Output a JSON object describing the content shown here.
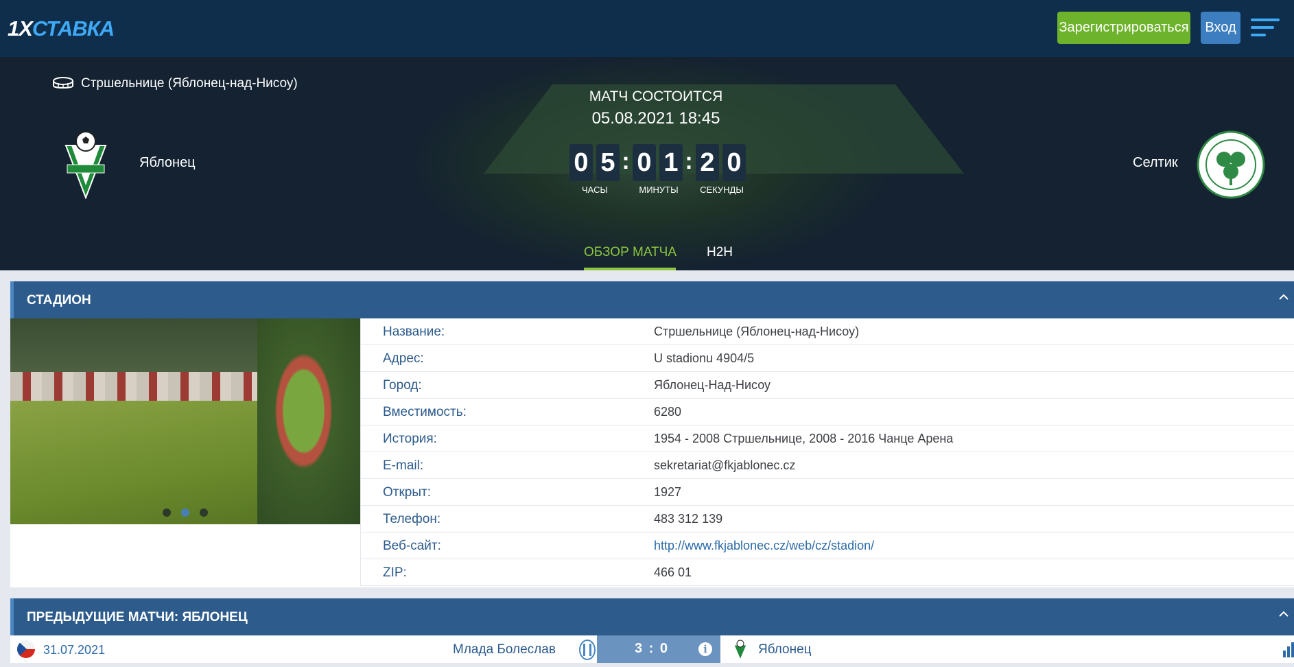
{
  "header": {
    "logo_prefix": "1X",
    "logo_suffix": "СТАВКА",
    "register_label": "Зарегистрироваться",
    "login_label": "Вход"
  },
  "match": {
    "venue": "Стршельнице (Яблонец-над-Нисоу)",
    "status": "МАТЧ СОСТОИТСЯ",
    "datetime": "05.08.2021 18:45",
    "home_team": "Яблонец",
    "away_team": "Селтик",
    "countdown": {
      "digits": [
        "0",
        "5",
        "0",
        "1",
        "2",
        "0"
      ],
      "units": [
        "ЧАСЫ",
        "МИНУТЫ",
        "СЕКУНДЫ"
      ]
    },
    "tabs": [
      {
        "label": "ОБЗОР МАТЧА",
        "active": true
      },
      {
        "label": "H2H",
        "active": false
      }
    ]
  },
  "stadium": {
    "section_title": "СТАДИОН",
    "photo_slide_count": 3,
    "photo_active_slide": 2,
    "rows": [
      {
        "label": "Название:",
        "value": "Стршельнице (Яблонец-над-Нисоу)"
      },
      {
        "label": "Адрес:",
        "value": "U stadionu 4904/5"
      },
      {
        "label": "Город:",
        "value": "Яблонец-Над-Нисоу"
      },
      {
        "label": "Вместимость:",
        "value": "6280"
      },
      {
        "label": "История:",
        "value": "1954 - 2008 Стршельнице, 2008 - 2016 Чанце Арена"
      },
      {
        "label": "E-mail:",
        "value": "sekretariat@fkjablonec.cz"
      },
      {
        "label": "Открыт:",
        "value": "1927"
      },
      {
        "label": "Телефон:",
        "value": "483 312 139"
      },
      {
        "label": "Веб-сайт:",
        "value": "http://www.fkjablonec.cz/web/cz/stadion/"
      },
      {
        "label": "ZIP:",
        "value": "466 01"
      }
    ]
  },
  "previous_matches": {
    "section_title": "ПРЕДЫДУЩИЕ МАТЧИ: ЯБЛОНЕЦ",
    "rows": [
      {
        "date": "31.07.2021",
        "home": "Млада Болеслав",
        "score": "3 : 0",
        "away": "Яблонец"
      }
    ]
  },
  "colors": {
    "topbar": "#0e2e4c",
    "accent_green": "#6db32b",
    "accent_blue": "#3d7ec1",
    "section_header": "#2c5b8c",
    "active_tab": "#8dc63f"
  }
}
